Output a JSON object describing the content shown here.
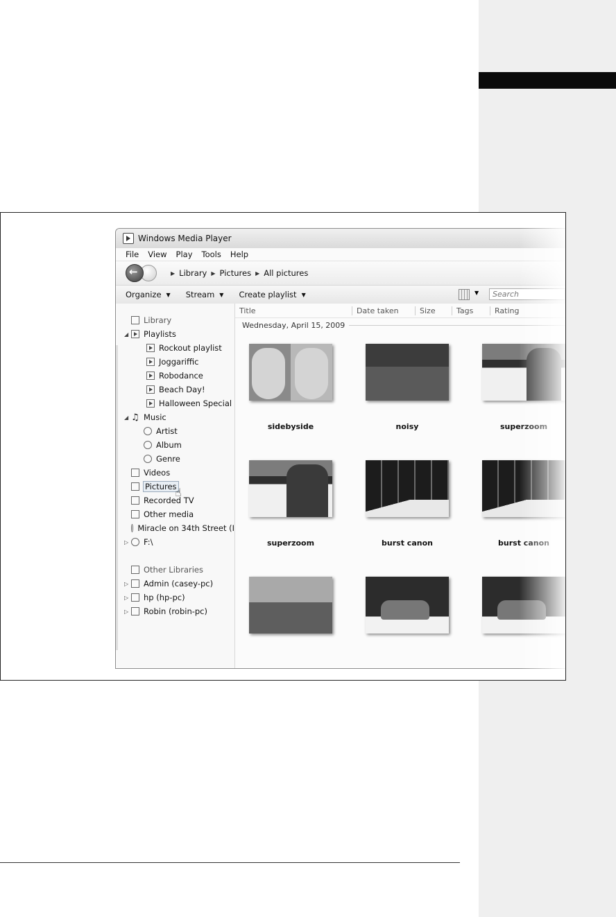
{
  "window": {
    "title": "Windows Media Player"
  },
  "menu": [
    "File",
    "View",
    "Play",
    "Tools",
    "Help"
  ],
  "breadcrumb": [
    "Library",
    "Pictures",
    "All pictures"
  ],
  "toolbar": {
    "organize": "Organize",
    "stream": "Stream",
    "create_playlist": "Create playlist",
    "search_placeholder": "Search"
  },
  "sidebar": {
    "library": "Library",
    "playlists": "Playlists",
    "playlist_items": [
      "Rockout playlist",
      "Joggariffic",
      "Robodance",
      "Beach Day!",
      "Halloween Special"
    ],
    "music": "Music",
    "music_items": [
      "Artist",
      "Album",
      "Genre"
    ],
    "videos": "Videos",
    "pictures": "Pictures",
    "recorded_tv": "Recorded TV",
    "other_media": "Other media",
    "miracle": "Miracle on 34th Street (I",
    "drive": "F:\\",
    "other_libraries": "Other Libraries",
    "libraries": [
      "Admin (casey-pc)",
      "hp (hp-pc)",
      "Robin (robin-pc)"
    ]
  },
  "columns": [
    "Title",
    "Date taken",
    "Size",
    "Tags",
    "Rating"
  ],
  "date_group": "Wednesday, April 15, 2009",
  "pictures": [
    {
      "title": "sidebyside"
    },
    {
      "title": "noisy"
    },
    {
      "title": "superzoom"
    },
    {
      "title": "superzoom"
    },
    {
      "title": "burst canon"
    },
    {
      "title": "burst canon"
    }
  ]
}
